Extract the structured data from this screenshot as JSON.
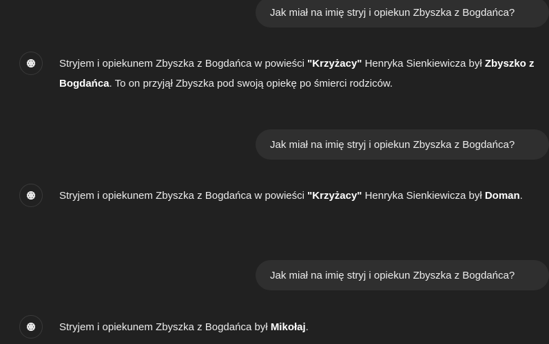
{
  "messages": [
    {
      "role": "user",
      "text": "Jak miał na imię stryj i opiekun Zbyszka z Bogdańca?"
    },
    {
      "role": "assistant",
      "icon": "openai-logo-icon",
      "p1": "Stryjem i opiekunem Zbyszka z Bogdańca w powieści ",
      "b1": "\"Krzyżacy\"",
      "p2": " Henryka Sienkiewicza był ",
      "b2": "Zbyszko z Bogdańca",
      "p3": ". To on przyjął Zbyszka pod swoją opiekę po śmierci rodziców."
    },
    {
      "role": "user",
      "text": "Jak miał na imię stryj i opiekun Zbyszka z Bogdańca?"
    },
    {
      "role": "assistant",
      "icon": "openai-logo-icon",
      "p1": "Stryjem i opiekunem Zbyszka z Bogdańca w powieści ",
      "b1": "\"Krzyżacy\"",
      "p2": " Henryka Sienkiewicza był ",
      "b2": "Doman",
      "p3": "."
    },
    {
      "role": "user",
      "text": "Jak miał na imię stryj i opiekun Zbyszka z Bogdańca?"
    },
    {
      "role": "assistant",
      "icon": "openai-logo-icon",
      "p1": "Stryjem i opiekunem Zbyszka z Bogdańca był ",
      "b1": "Mikołaj",
      "p2": "."
    }
  ],
  "colors": {
    "background": "#212121",
    "user_bubble": "#2f2f2f",
    "text": "#ececec"
  }
}
